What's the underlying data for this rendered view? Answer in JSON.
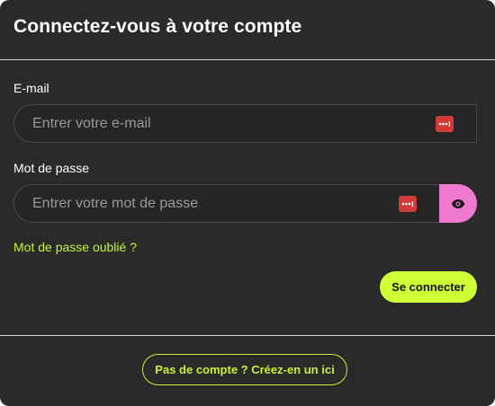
{
  "modal": {
    "title": "Connectez-vous à votre compte"
  },
  "form": {
    "email": {
      "label": "E-mail",
      "placeholder": "Entrer votre e-mail",
      "value": ""
    },
    "password": {
      "label": "Mot de passe",
      "placeholder": "Entrer votre mot de passe",
      "value": ""
    },
    "forgot_password": "Mot de passe oublié ?",
    "submit_label": "Se connecter"
  },
  "footer": {
    "signup_label": "Pas de compte ? Créez-en un ici"
  },
  "icons": {
    "password_manager": "password-manager-icon",
    "toggle_visibility": "eye-icon"
  },
  "colors": {
    "background": "#2a2a2a",
    "accent_lime": "#ceff35",
    "link_lime": "#c7f23b",
    "eye_button_pink": "#f07ad0",
    "password_manager_red": "#d33b3b"
  }
}
